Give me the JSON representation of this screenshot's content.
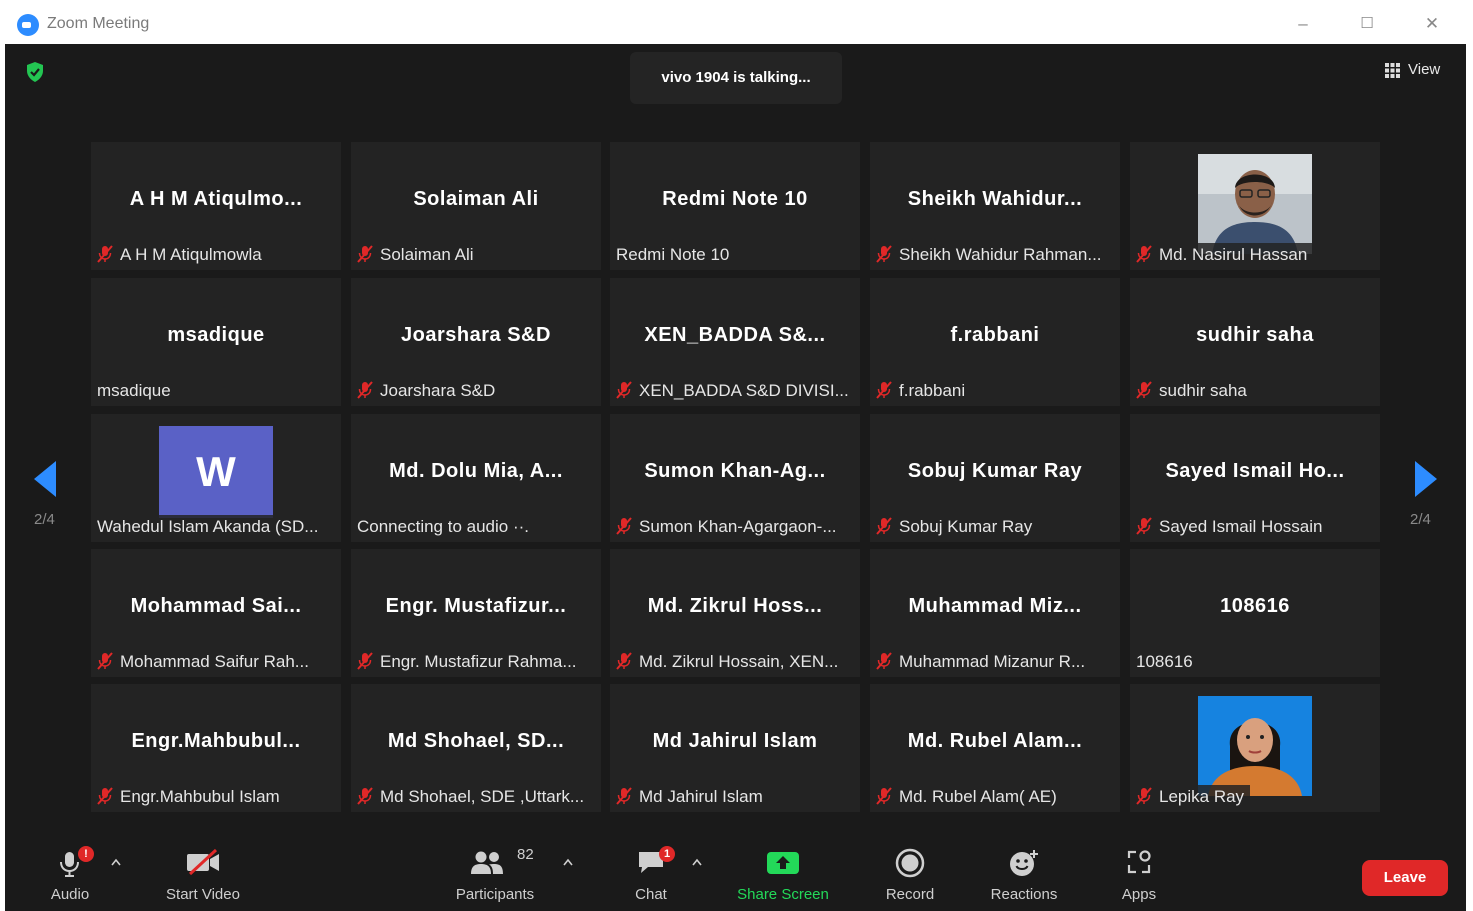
{
  "window": {
    "title": "Zoom Meeting",
    "minimize": "–",
    "maximize": "☐",
    "close": "✕"
  },
  "header": {
    "talking": "vivo 1904 is talking...",
    "view_label": "View"
  },
  "pager": {
    "left": "2/4",
    "right": "2/4"
  },
  "tiles": [
    {
      "big": "A H M Atiqulmo...",
      "name": "A H M Atiqulmowla",
      "muted": true
    },
    {
      "big": "Solaiman Ali",
      "name": "Solaiman Ali",
      "muted": true
    },
    {
      "big": "Redmi Note 10",
      "name": "Redmi Note 10",
      "muted": false
    },
    {
      "big": "Sheikh  Wahidur...",
      "name": "Sheikh Wahidur Rahman...",
      "muted": true
    },
    {
      "big": "",
      "name": "Md. Nasirul Hassan",
      "muted": true,
      "photo": "man"
    },
    {
      "big": "msadique",
      "name": "msadique",
      "muted": false
    },
    {
      "big": "Joarshara S&D",
      "name": "Joarshara S&D",
      "muted": true
    },
    {
      "big": "XEN_BADDA S&...",
      "name": "XEN_BADDA S&D DIVISI...",
      "muted": true
    },
    {
      "big": "f.rabbani",
      "name": "f.rabbani",
      "muted": true
    },
    {
      "big": "sudhir saha",
      "name": "sudhir saha",
      "muted": true
    },
    {
      "big": "",
      "name": "Wahedul Islam Akanda (SD...",
      "muted": false,
      "avatar": "W"
    },
    {
      "big": "Md. Dolu Mia, A...",
      "name": "Connecting to audio ··.",
      "muted": false
    },
    {
      "big": "Sumon  Khan-Ag...",
      "name": "Sumon Khan-Agargaon-...",
      "muted": true
    },
    {
      "big": "Sobuj Kumar Ray",
      "name": "Sobuj Kumar Ray",
      "muted": true
    },
    {
      "big": "Sayed  Ismail  Ho...",
      "name": "Sayed Ismail Hossain",
      "muted": true
    },
    {
      "big": "Mohammad  Sai...",
      "name": "Mohammad Saifur Rah...",
      "muted": true
    },
    {
      "big": "Engr.  Mustafizur...",
      "name": "Engr. Mustafizur Rahma...",
      "muted": true
    },
    {
      "big": "Md.  Zikrul  Hoss...",
      "name": "Md. Zikrul Hossain, XEN...",
      "muted": true
    },
    {
      "big": "Muhammad  Miz...",
      "name": "Muhammad Mizanur  R...",
      "muted": true
    },
    {
      "big": "108616",
      "name": "108616",
      "muted": false
    },
    {
      "big": "Engr.Mahbubul...",
      "name": "Engr.Mahbubul Islam",
      "muted": true
    },
    {
      "big": "Md  Shohael,  SD...",
      "name": "Md Shohael, SDE ,Uttark...",
      "muted": true
    },
    {
      "big": "Md Jahirul Islam",
      "name": "Md Jahirul Islam",
      "muted": true
    },
    {
      "big": "Md.  Rubel  Alam...",
      "name": "Md. Rubel Alam( AE)",
      "muted": true
    },
    {
      "big": "",
      "name": "Lepika Ray",
      "muted": true,
      "photo": "woman"
    }
  ],
  "toolbar": {
    "audio": "Audio",
    "start_video": "Start Video",
    "participants": "Participants",
    "participant_count": "82",
    "chat": "Chat",
    "chat_badge": "1",
    "share_screen": "Share Screen",
    "record": "Record",
    "reactions": "Reactions",
    "apps": "Apps",
    "leave": "Leave"
  },
  "colors": {
    "accent": "#2d8cff",
    "share_green": "#23d959",
    "leave_red": "#e02828",
    "muted_red": "#e02828"
  }
}
